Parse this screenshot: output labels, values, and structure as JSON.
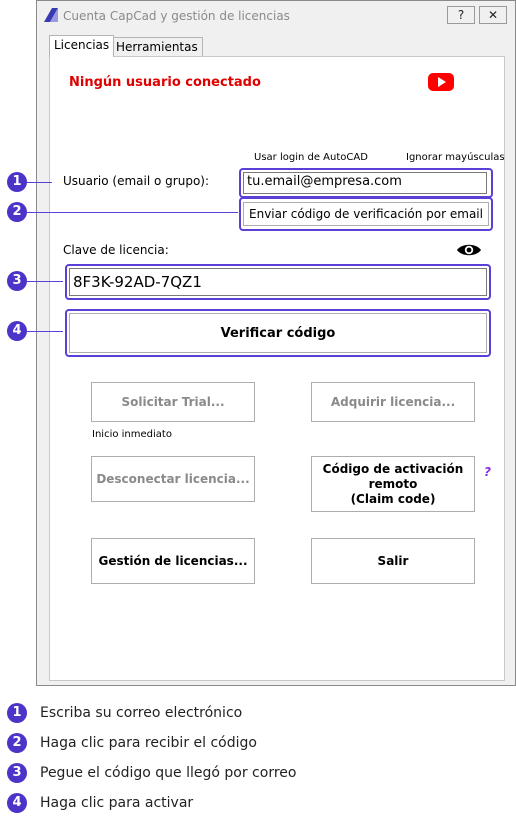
{
  "window": {
    "title": "Cuenta CapCad y gestión de licencias",
    "help_label": "?",
    "close_label": "✕"
  },
  "tabs": [
    {
      "label": "Licencias",
      "active": true
    },
    {
      "label": "Herramientas",
      "active": false
    }
  ],
  "status": {
    "text": "Ningún usuario conectado",
    "color": "#e00000"
  },
  "options": {
    "autocad_login": "Usar login de AutoCAD",
    "ignore_case": "Ignorar mayúsculas"
  },
  "user": {
    "label": "Usuario (email o grupo):",
    "value": "tu.email@empresa.com"
  },
  "buttons": {
    "send_code": "Enviar código de verificación por email",
    "verify": "Verificar código",
    "trial": "Solicitar Trial...",
    "buy": "Adquirir licencia...",
    "disconnect": "Desconectar licencia...",
    "claim_line1": "Código de activación",
    "claim_line2": "remoto",
    "claim_line3": "(Claim code)",
    "manage": "Gestión de licencias...",
    "exit": "Salir"
  },
  "license": {
    "label": "Clave de licencia:",
    "value": "8F3K-92AD-7QZ1"
  },
  "trial_note": "Inicio inmediato",
  "help_mark": "?",
  "icons": {
    "youtube": "youtube-icon",
    "eye": "eye-icon",
    "app": "capcad-logo-icon"
  },
  "callouts": [
    {
      "num": "1",
      "text": "Escriba su correo electrónico"
    },
    {
      "num": "2",
      "text": "Haga clic para recibir el código"
    },
    {
      "num": "3",
      "text": "Pegue el código que llegó por correo"
    },
    {
      "num": "4",
      "text": "Haga clic para activar"
    }
  ],
  "accent_color": "#5b3fd6"
}
